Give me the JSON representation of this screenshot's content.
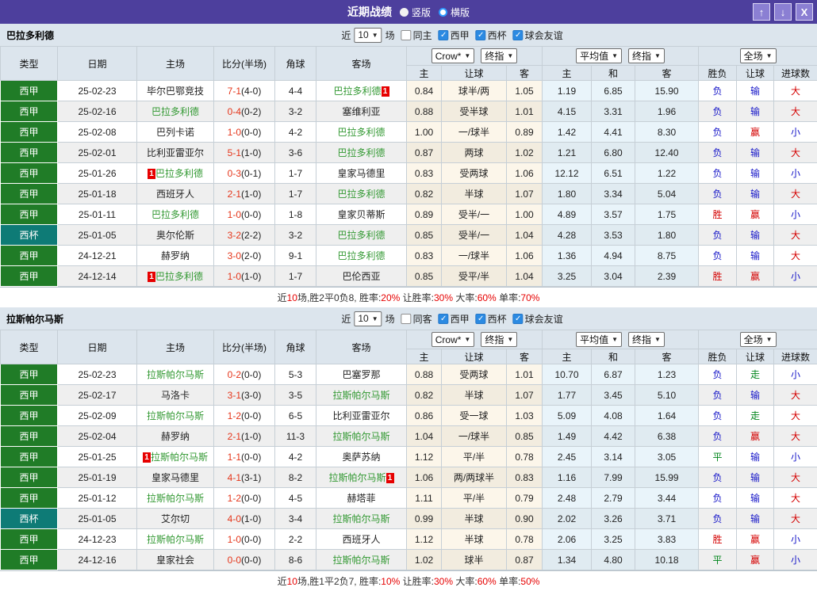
{
  "titlebar": {
    "title": "近期战绩",
    "radio_vertical": "竖版",
    "radio_horizontal": "横版",
    "up_icon": "↑",
    "down_icon": "↓",
    "close_icon": "X"
  },
  "table_header": {
    "cols": [
      "类型",
      "日期",
      "主场",
      "比分(半场)",
      "角球",
      "客场"
    ],
    "selects": {
      "crow": "Crow*",
      "final1": "终指",
      "avg": "平均值",
      "final2": "终指",
      "full": "全场"
    },
    "sub": [
      "主",
      "让球",
      "客",
      "主",
      "和",
      "客",
      "胜负",
      "让球",
      "进球数"
    ]
  },
  "outcome_colors": {
    "胜": "#d40000",
    "平": "#00851b",
    "负": "#1515c8",
    "赢": "#d40000",
    "走": "#00851b",
    "输": "#1515c8",
    "大": "#d40000",
    "小": "#1515c8"
  },
  "sections": [
    {
      "team": "巴拉多利德",
      "filter": {
        "prefix": "近",
        "count": "10",
        "suffix": "场",
        "same_label": "同主",
        "same_checked": false,
        "leagues": [
          {
            "label": "西甲",
            "checked": true
          },
          {
            "label": "西杯",
            "checked": true
          },
          {
            "label": "球会友谊",
            "checked": true
          }
        ]
      },
      "rows": [
        {
          "type": "西甲",
          "type_style": "liga",
          "date": "25-02-23",
          "home": "毕尔巴鄂竞技",
          "home_green": false,
          "home_badge": "",
          "score_ft": "7-1",
          "score_ht": "(4-0)",
          "corner": "4-4",
          "away": "巴拉多利德",
          "away_green": true,
          "away_badge": "1",
          "odds": [
            "0.84",
            "球半/两",
            "1.05"
          ],
          "avg": [
            "1.19",
            "6.85",
            "15.90"
          ],
          "results": [
            "负",
            "输",
            "大"
          ]
        },
        {
          "type": "西甲",
          "type_style": "liga",
          "date": "25-02-16",
          "home": "巴拉多利德",
          "home_green": true,
          "home_badge": "",
          "score_ft": "0-4",
          "score_ht": "(0-2)",
          "corner": "3-2",
          "away": "塞维利亚",
          "away_green": false,
          "away_badge": "",
          "odds": [
            "0.88",
            "受半球",
            "1.01"
          ],
          "avg": [
            "4.15",
            "3.31",
            "1.96"
          ],
          "results": [
            "负",
            "输",
            "大"
          ]
        },
        {
          "type": "西甲",
          "type_style": "liga",
          "date": "25-02-08",
          "home": "巴列卡诺",
          "home_green": false,
          "home_badge": "",
          "score_ft": "1-0",
          "score_ht": "(0-0)",
          "corner": "4-2",
          "away": "巴拉多利德",
          "away_green": true,
          "away_badge": "",
          "odds": [
            "1.00",
            "一/球半",
            "0.89"
          ],
          "avg": [
            "1.42",
            "4.41",
            "8.30"
          ],
          "results": [
            "负",
            "赢",
            "小"
          ]
        },
        {
          "type": "西甲",
          "type_style": "liga",
          "date": "25-02-01",
          "home": "比利亚雷亚尔",
          "home_green": false,
          "home_badge": "",
          "score_ft": "5-1",
          "score_ht": "(1-0)",
          "corner": "3-6",
          "away": "巴拉多利德",
          "away_green": true,
          "away_badge": "",
          "odds": [
            "0.87",
            "两球",
            "1.02"
          ],
          "avg": [
            "1.21",
            "6.80",
            "12.40"
          ],
          "results": [
            "负",
            "输",
            "大"
          ]
        },
        {
          "type": "西甲",
          "type_style": "liga",
          "date": "25-01-26",
          "home": "巴拉多利德",
          "home_green": true,
          "home_badge": "1",
          "score_ft": "0-3",
          "score_ht": "(0-1)",
          "corner": "1-7",
          "away": "皇家马德里",
          "away_green": false,
          "away_badge": "",
          "odds": [
            "0.83",
            "受两球",
            "1.06"
          ],
          "avg": [
            "12.12",
            "6.51",
            "1.22"
          ],
          "results": [
            "负",
            "输",
            "小"
          ]
        },
        {
          "type": "西甲",
          "type_style": "liga",
          "date": "25-01-18",
          "home": "西班牙人",
          "home_green": false,
          "home_badge": "",
          "score_ft": "2-1",
          "score_ht": "(1-0)",
          "corner": "1-7",
          "away": "巴拉多利德",
          "away_green": true,
          "away_badge": "",
          "odds": [
            "0.82",
            "半球",
            "1.07"
          ],
          "avg": [
            "1.80",
            "3.34",
            "5.04"
          ],
          "results": [
            "负",
            "输",
            "大"
          ]
        },
        {
          "type": "西甲",
          "type_style": "liga",
          "date": "25-01-11",
          "home": "巴拉多利德",
          "home_green": true,
          "home_badge": "",
          "score_ft": "1-0",
          "score_ht": "(0-0)",
          "corner": "1-8",
          "away": "皇家贝蒂斯",
          "away_green": false,
          "away_badge": "",
          "odds": [
            "0.89",
            "受半/一",
            "1.00"
          ],
          "avg": [
            "4.89",
            "3.57",
            "1.75"
          ],
          "results": [
            "胜",
            "赢",
            "小"
          ]
        },
        {
          "type": "西杯",
          "type_style": "cup",
          "date": "25-01-05",
          "home": "奥尔伦斯",
          "home_green": false,
          "home_badge": "",
          "score_ft": "3-2",
          "score_ht": "(2-2)",
          "corner": "3-2",
          "away": "巴拉多利德",
          "away_green": true,
          "away_badge": "",
          "odds": [
            "0.85",
            "受半/一",
            "1.04"
          ],
          "avg": [
            "4.28",
            "3.53",
            "1.80"
          ],
          "results": [
            "负",
            "输",
            "大"
          ]
        },
        {
          "type": "西甲",
          "type_style": "liga",
          "date": "24-12-21",
          "home": "赫罗纳",
          "home_green": false,
          "home_badge": "",
          "score_ft": "3-0",
          "score_ht": "(2-0)",
          "corner": "9-1",
          "away": "巴拉多利德",
          "away_green": true,
          "away_badge": "",
          "odds": [
            "0.83",
            "一/球半",
            "1.06"
          ],
          "avg": [
            "1.36",
            "4.94",
            "8.75"
          ],
          "results": [
            "负",
            "输",
            "大"
          ]
        },
        {
          "type": "西甲",
          "type_style": "liga",
          "date": "24-12-14",
          "home": "巴拉多利德",
          "home_green": true,
          "home_badge": "1",
          "score_ft": "1-0",
          "score_ht": "(1-0)",
          "corner": "1-7",
          "away": "巴伦西亚",
          "away_green": false,
          "away_badge": "",
          "odds": [
            "0.85",
            "受平/半",
            "1.04"
          ],
          "avg": [
            "3.25",
            "3.04",
            "2.39"
          ],
          "results": [
            "胜",
            "赢",
            "小"
          ]
        }
      ],
      "summary": [
        [
          "近",
          0
        ],
        [
          "10",
          1
        ],
        [
          "场,胜2平0负8, 胜率:",
          0
        ],
        [
          "20%",
          1
        ],
        [
          " 让胜率:",
          0
        ],
        [
          "30%",
          1
        ],
        [
          " 大率:",
          0
        ],
        [
          "60%",
          1
        ],
        [
          " 单率:",
          0
        ],
        [
          "70%",
          1
        ]
      ]
    },
    {
      "team": "拉斯帕尔马斯",
      "filter": {
        "prefix": "近",
        "count": "10",
        "suffix": "场",
        "same_label": "同客",
        "same_checked": false,
        "leagues": [
          {
            "label": "西甲",
            "checked": true
          },
          {
            "label": "西杯",
            "checked": true
          },
          {
            "label": "球会友谊",
            "checked": true
          }
        ]
      },
      "rows": [
        {
          "type": "西甲",
          "type_style": "liga",
          "date": "25-02-23",
          "home": "拉斯帕尔马斯",
          "home_green": true,
          "home_badge": "",
          "score_ft": "0-2",
          "score_ht": "(0-0)",
          "corner": "5-3",
          "away": "巴塞罗那",
          "away_green": false,
          "away_badge": "",
          "odds": [
            "0.88",
            "受两球",
            "1.01"
          ],
          "avg": [
            "10.70",
            "6.87",
            "1.23"
          ],
          "results": [
            "负",
            "走",
            "小"
          ]
        },
        {
          "type": "西甲",
          "type_style": "liga",
          "date": "25-02-17",
          "home": "马洛卡",
          "home_green": false,
          "home_badge": "",
          "score_ft": "3-1",
          "score_ht": "(3-0)",
          "corner": "3-5",
          "away": "拉斯帕尔马斯",
          "away_green": true,
          "away_badge": "",
          "odds": [
            "0.82",
            "半球",
            "1.07"
          ],
          "avg": [
            "1.77",
            "3.45",
            "5.10"
          ],
          "results": [
            "负",
            "输",
            "大"
          ]
        },
        {
          "type": "西甲",
          "type_style": "liga",
          "date": "25-02-09",
          "home": "拉斯帕尔马斯",
          "home_green": true,
          "home_badge": "",
          "score_ft": "1-2",
          "score_ht": "(0-0)",
          "corner": "6-5",
          "away": "比利亚雷亚尔",
          "away_green": false,
          "away_badge": "",
          "odds": [
            "0.86",
            "受一球",
            "1.03"
          ],
          "avg": [
            "5.09",
            "4.08",
            "1.64"
          ],
          "results": [
            "负",
            "走",
            "大"
          ]
        },
        {
          "type": "西甲",
          "type_style": "liga",
          "date": "25-02-04",
          "home": "赫罗纳",
          "home_green": false,
          "home_badge": "",
          "score_ft": "2-1",
          "score_ht": "(1-0)",
          "corner": "11-3",
          "away": "拉斯帕尔马斯",
          "away_green": true,
          "away_badge": "",
          "odds": [
            "1.04",
            "一/球半",
            "0.85"
          ],
          "avg": [
            "1.49",
            "4.42",
            "6.38"
          ],
          "results": [
            "负",
            "赢",
            "大"
          ]
        },
        {
          "type": "西甲",
          "type_style": "liga",
          "date": "25-01-25",
          "home": "拉斯帕尔马斯",
          "home_green": true,
          "home_badge": "1",
          "score_ft": "1-1",
          "score_ht": "(0-0)",
          "corner": "4-2",
          "away": "奥萨苏纳",
          "away_green": false,
          "away_badge": "",
          "odds": [
            "1.12",
            "平/半",
            "0.78"
          ],
          "avg": [
            "2.45",
            "3.14",
            "3.05"
          ],
          "results": [
            "平",
            "输",
            "小"
          ]
        },
        {
          "type": "西甲",
          "type_style": "liga",
          "date": "25-01-19",
          "home": "皇家马德里",
          "home_green": false,
          "home_badge": "",
          "score_ft": "4-1",
          "score_ht": "(3-1)",
          "corner": "8-2",
          "away": "拉斯帕尔马斯",
          "away_green": true,
          "away_badge": "1",
          "odds": [
            "1.06",
            "两/两球半",
            "0.83"
          ],
          "avg": [
            "1.16",
            "7.99",
            "15.99"
          ],
          "results": [
            "负",
            "输",
            "大"
          ]
        },
        {
          "type": "西甲",
          "type_style": "liga",
          "date": "25-01-12",
          "home": "拉斯帕尔马斯",
          "home_green": true,
          "home_badge": "",
          "score_ft": "1-2",
          "score_ht": "(0-0)",
          "corner": "4-5",
          "away": "赫塔菲",
          "away_green": false,
          "away_badge": "",
          "odds": [
            "1.11",
            "平/半",
            "0.79"
          ],
          "avg": [
            "2.48",
            "2.79",
            "3.44"
          ],
          "results": [
            "负",
            "输",
            "大"
          ]
        },
        {
          "type": "西杯",
          "type_style": "cup",
          "date": "25-01-05",
          "home": "艾尔切",
          "home_green": false,
          "home_badge": "",
          "score_ft": "4-0",
          "score_ht": "(1-0)",
          "corner": "3-4",
          "away": "拉斯帕尔马斯",
          "away_green": true,
          "away_badge": "",
          "odds": [
            "0.99",
            "半球",
            "0.90"
          ],
          "avg": [
            "2.02",
            "3.26",
            "3.71"
          ],
          "results": [
            "负",
            "输",
            "大"
          ]
        },
        {
          "type": "西甲",
          "type_style": "liga",
          "date": "24-12-23",
          "home": "拉斯帕尔马斯",
          "home_green": true,
          "home_badge": "",
          "score_ft": "1-0",
          "score_ht": "(0-0)",
          "corner": "2-2",
          "away": "西班牙人",
          "away_green": false,
          "away_badge": "",
          "odds": [
            "1.12",
            "半球",
            "0.78"
          ],
          "avg": [
            "2.06",
            "3.25",
            "3.83"
          ],
          "results": [
            "胜",
            "赢",
            "小"
          ]
        },
        {
          "type": "西甲",
          "type_style": "liga",
          "date": "24-12-16",
          "home": "皇家社会",
          "home_green": false,
          "home_badge": "",
          "score_ft": "0-0",
          "score_ht": "(0-0)",
          "corner": "8-6",
          "away": "拉斯帕尔马斯",
          "away_green": true,
          "away_badge": "",
          "odds": [
            "1.02",
            "球半",
            "0.87"
          ],
          "avg": [
            "1.34",
            "4.80",
            "10.18"
          ],
          "results": [
            "平",
            "赢",
            "小"
          ]
        }
      ],
      "summary": [
        [
          "近",
          0
        ],
        [
          "10",
          1
        ],
        [
          "场,胜1平2负7, 胜率:",
          0
        ],
        [
          "10%",
          1
        ],
        [
          " 让胜率:",
          0
        ],
        [
          "30%",
          1
        ],
        [
          " 大率:",
          0
        ],
        [
          "60%",
          1
        ],
        [
          " 单率:",
          0
        ],
        [
          "50%",
          1
        ]
      ]
    }
  ]
}
